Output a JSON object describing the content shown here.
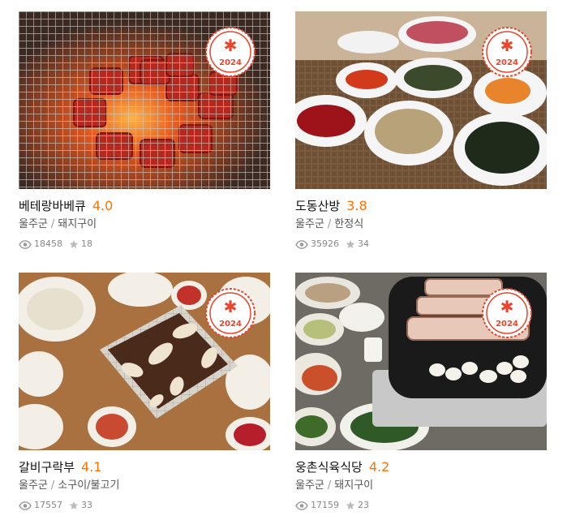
{
  "cards": [
    {
      "name": "베테랑바베큐",
      "rating": "4.0",
      "region": "울주군",
      "category": "돼지구이",
      "views": "18458",
      "stars": "18",
      "badge": "2024"
    },
    {
      "name": "도동산방",
      "rating": "3.8",
      "region": "울주군",
      "category": "한정식",
      "views": "35926",
      "stars": "34",
      "badge": "2024"
    },
    {
      "name": "갈비구락부",
      "rating": "4.1",
      "region": "울주군",
      "category": "소구이/불고기",
      "views": "17557",
      "stars": "33",
      "badge": "2024"
    },
    {
      "name": "웅촌식육식당",
      "rating": "4.2",
      "region": "울주군",
      "category": "돼지구이",
      "views": "17159",
      "stars": "23",
      "badge": "2024"
    }
  ],
  "separator": "/",
  "colors": {
    "rating": "#ff7100",
    "badge": "#e8452c"
  }
}
